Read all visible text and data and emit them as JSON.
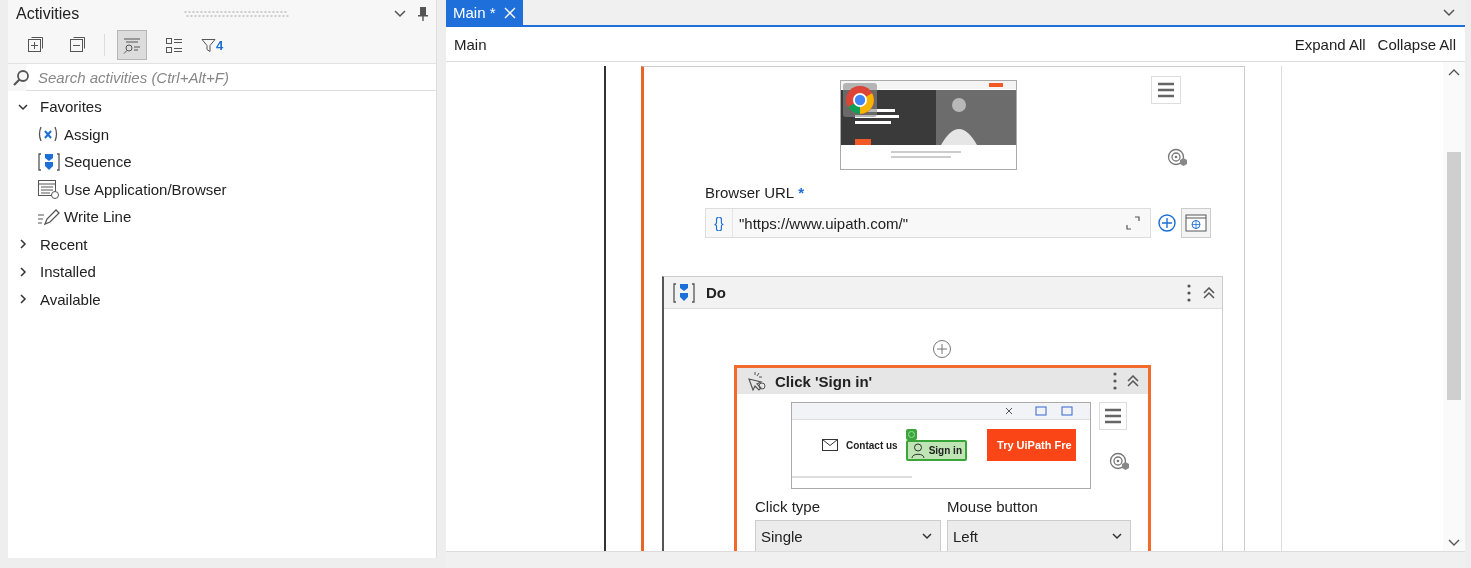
{
  "activities_panel": {
    "title": "Activities",
    "toolbar": [
      {
        "kind": "expand",
        "selected": false
      },
      {
        "kind": "collapse",
        "selected": false
      },
      {
        "kind": "descriptions",
        "selected": true
      },
      {
        "kind": "list",
        "selected": false
      }
    ],
    "filter_count": "4",
    "search": {
      "placeholder": "Search activities (Ctrl+Alt+F)"
    },
    "tree": [
      {
        "label": "Favorites",
        "expanded": true,
        "children": [
          {
            "label": "Assign",
            "kind": "assign"
          },
          {
            "label": "Sequence",
            "kind": "sequence"
          },
          {
            "label": "Use Application/Browser",
            "kind": "browser"
          },
          {
            "label": "Write Line",
            "kind": "writeline"
          }
        ]
      },
      {
        "label": "Recent",
        "expanded": false
      },
      {
        "label": "Installed",
        "expanded": false
      },
      {
        "label": "Available",
        "expanded": false
      }
    ]
  },
  "document_tabs": [
    {
      "label": "Main *",
      "selected": true
    }
  ],
  "breadcrumb": "Main",
  "actions": [
    "Expand All",
    "Collapse All"
  ],
  "designer": {
    "browser_activity": {
      "selected": true,
      "url_label": "Browser URL",
      "required_mark": "*",
      "url_prefix": "{}",
      "url_value": "\"https://www.uipath.com/\""
    },
    "do_sequence": {
      "title": "Do",
      "expanded": true,
      "activity": {
        "title": "Click 'Sign in'",
        "selected": true,
        "target": {
          "contact": "Contact us",
          "sign_in": "Sign in",
          "cta": "Try UiPath Fre"
        },
        "fields": [
          {
            "label": "Click type",
            "value": "Single"
          },
          {
            "label": "Mouse button",
            "value": "Left"
          }
        ]
      }
    }
  }
}
